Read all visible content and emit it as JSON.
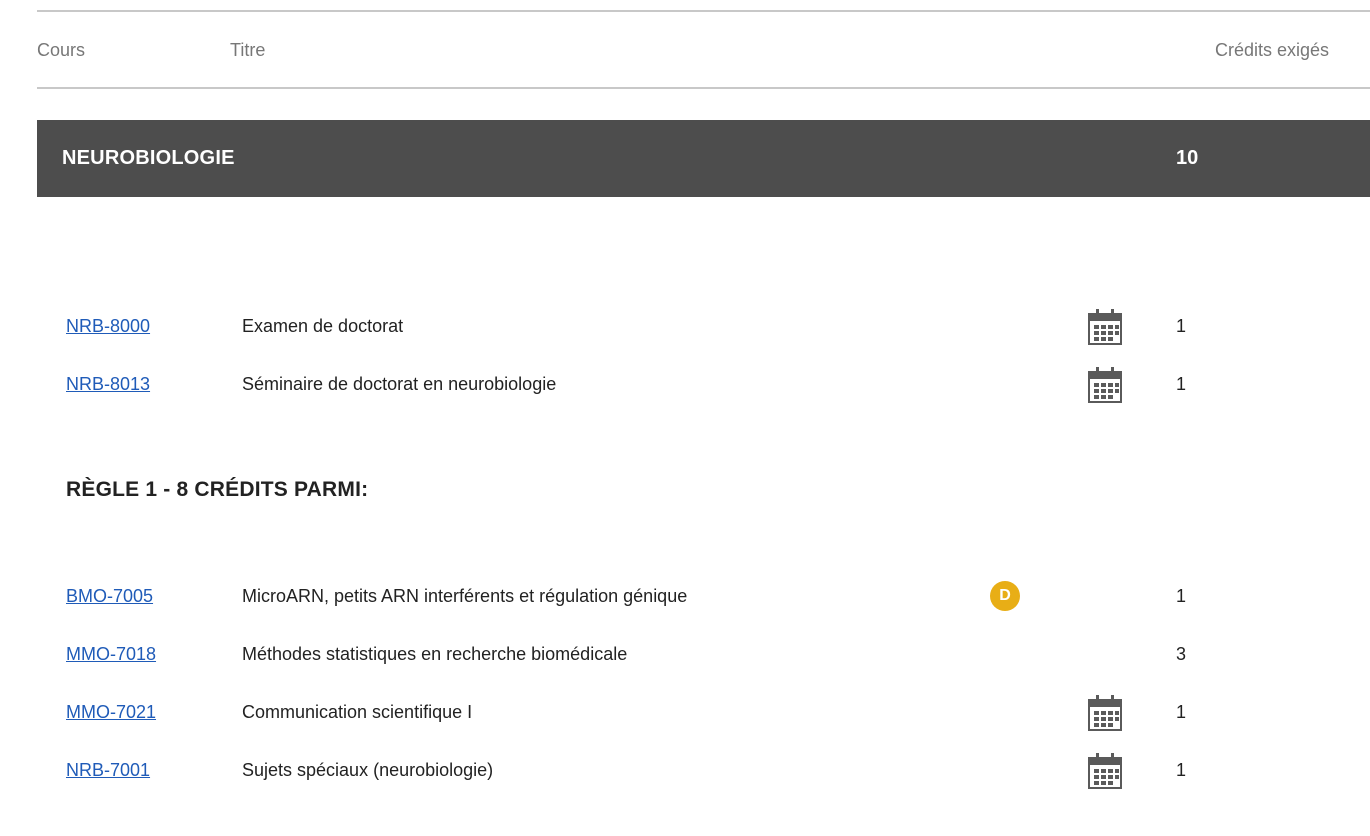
{
  "table_header": {
    "cours": "Cours",
    "titre": "Titre",
    "credits": "Crédits exigés"
  },
  "section": {
    "title": "NEUROBIOLOGIE",
    "credits": "10"
  },
  "required_courses": [
    {
      "code": "NRB-8000",
      "title": "Examen de doctorat",
      "credits": "1",
      "icon": "calendar-icon"
    },
    {
      "code": "NRB-8013",
      "title": "Séminaire de doctorat en neurobiologie",
      "credits": "1",
      "icon": "calendar-icon"
    }
  ],
  "rule": {
    "title": "RÈGLE 1 - 8 CRÉDITS PARMI:"
  },
  "rule_courses": [
    {
      "code": "BMO-7005",
      "title": "MicroARN, petits ARN interférents et régulation génique",
      "credits": "1",
      "badge": "D",
      "badge_color": "#e8ae16"
    },
    {
      "code": "MMO-7018",
      "title": "Méthodes statistiques en recherche biomédicale",
      "credits": "3"
    },
    {
      "code": "MMO-7021",
      "title": "Communication scientifique I",
      "credits": "1",
      "icon": "calendar-icon"
    },
    {
      "code": "NRB-7001",
      "title": "Sujets spéciaux (neurobiologie)",
      "credits": "1",
      "icon": "calendar-icon"
    }
  ],
  "colors": {
    "link": "#1f5bb8",
    "section_bar": "#4d4d4d",
    "calendar_icon": "#5a5a5a"
  }
}
